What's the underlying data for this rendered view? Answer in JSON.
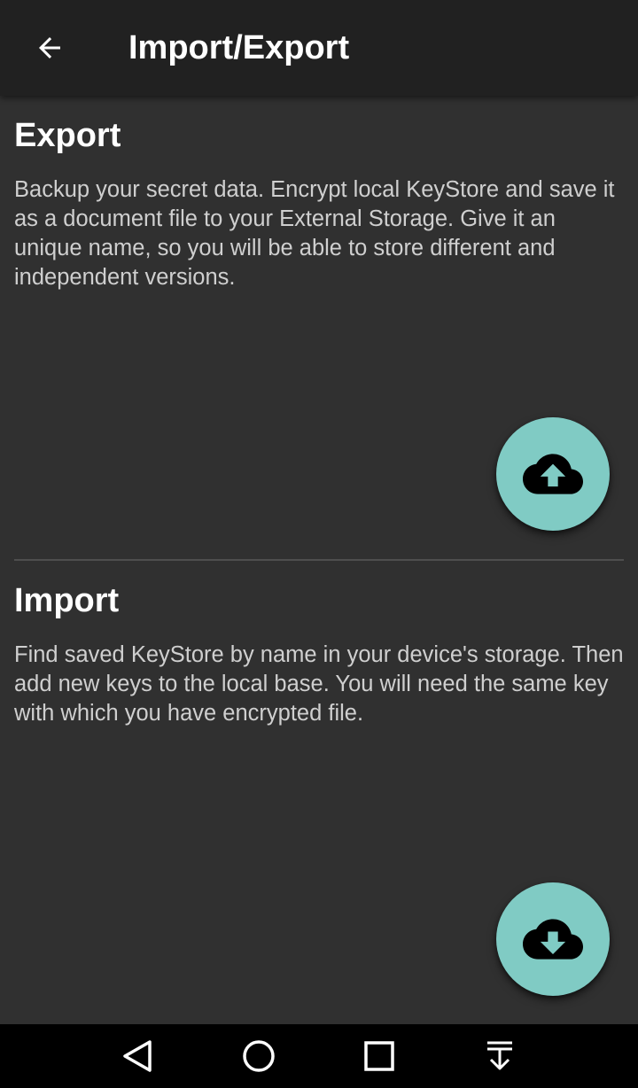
{
  "appbar": {
    "title": "Import/Export",
    "back_icon": "arrow-back-icon"
  },
  "export": {
    "title": "Export",
    "description": "Backup your secret data. Encrypt local KeyStore and save it as a document file to your External Storage. Give it an unique name, so you will be able to store different and independent versions.",
    "button_icon": "cloud-upload-icon"
  },
  "import": {
    "title": "Import",
    "description": "Find saved KeyStore by name in your device's storage. Then add new keys to the local base. You will need the same key with which you have encrypted file.",
    "button_icon": "cloud-download-icon"
  },
  "navbar": {
    "buttons": [
      "back-triangle-icon",
      "home-circle-icon",
      "recents-square-icon",
      "notifications-pulldown-icon"
    ]
  },
  "colors": {
    "background": "#303030",
    "appbar": "#212121",
    "accent": "#80cbc4",
    "text_primary": "#ffffff",
    "text_secondary": "#cfcfcf"
  }
}
